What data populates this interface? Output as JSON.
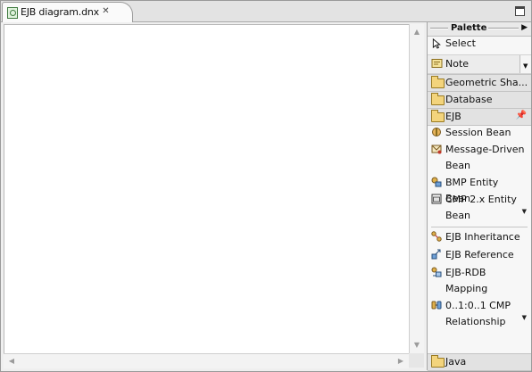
{
  "editor": {
    "tab_label": "EJB diagram.dnx",
    "tab_icon": "diagram-file-icon",
    "close_icon": "close-icon",
    "maximize_icon": "maximize-icon"
  },
  "palette": {
    "title": "Palette",
    "menu_icon": "triangle-right-icon",
    "tools_top": [
      {
        "label": "Select",
        "icon": "arrow-cursor-icon"
      },
      {
        "label": "Note",
        "icon": "note-icon"
      }
    ],
    "drawers": {
      "geometric": "Geometric Sha...",
      "database": "Database",
      "ejb": "EJB",
      "java": "Java"
    },
    "ejb_tools": [
      {
        "label": "Session Bean",
        "icon": "session-bean-icon"
      },
      {
        "label": "Message-Driven Bean",
        "icon": "message-bean-icon"
      },
      {
        "label": "BMP Entity Bean",
        "icon": "bmp-entity-icon"
      },
      {
        "label": "CMP 2.x Entity Bean",
        "icon": "cmp-entity-icon"
      },
      {
        "label": "EJB Inheritance",
        "icon": "inheritance-icon"
      },
      {
        "label": "EJB Reference",
        "icon": "reference-icon"
      },
      {
        "label": "EJB-RDB Mapping",
        "icon": "mapping-icon"
      },
      {
        "label": "0..1:0..1 CMP Relationship",
        "icon": "relationship-icon"
      }
    ]
  },
  "colors": {
    "folder": "#f3d47c",
    "canvas": "#ffffff",
    "chrome": "#e6e6e6"
  }
}
